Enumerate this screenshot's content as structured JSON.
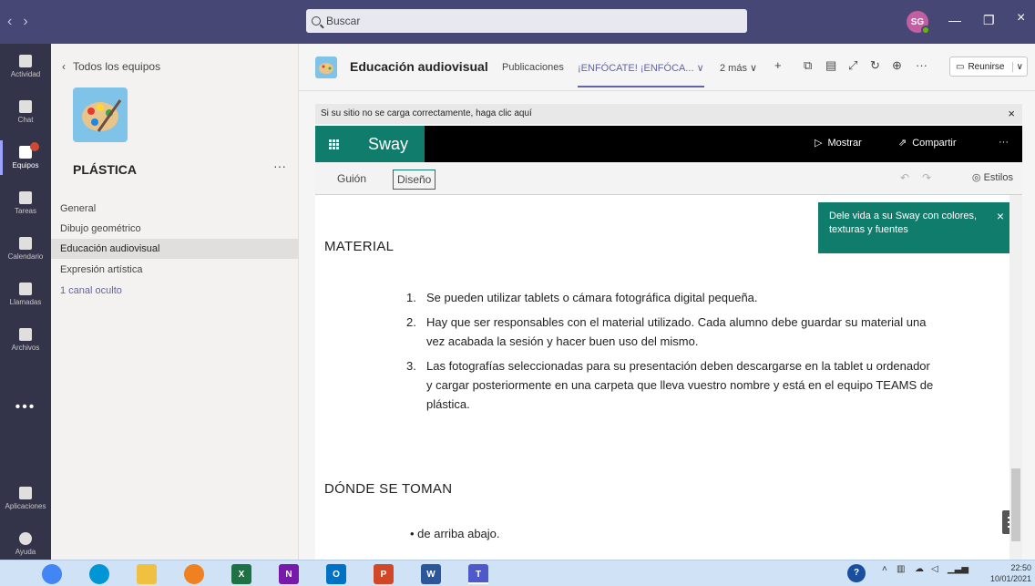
{
  "titlebar": {
    "back": "‹",
    "forward": "›",
    "search_placeholder": "Buscar",
    "avatar_initials": "SG",
    "minimize": "—",
    "maximize": "❐",
    "close": "×"
  },
  "rail": {
    "items": [
      {
        "label": "Actividad"
      },
      {
        "label": "Chat"
      },
      {
        "label": "Equipos"
      },
      {
        "label": "Tareas"
      },
      {
        "label": "Calendario"
      },
      {
        "label": "Llamadas"
      },
      {
        "label": "Archivos"
      }
    ],
    "more": "•••",
    "bottom": [
      {
        "label": "Aplicaciones"
      },
      {
        "label": "Ayuda"
      }
    ]
  },
  "sidebar": {
    "back_label": "Todos los equipos",
    "team_name": "PLÁSTICA",
    "team_more": "···",
    "channels": [
      {
        "label": "General"
      },
      {
        "label": "Dibujo geométrico"
      },
      {
        "label": "Educación audiovisual"
      },
      {
        "label": "Expresión artística"
      },
      {
        "label": "1 canal oculto"
      }
    ]
  },
  "channel": {
    "title": "Educación audiovisual",
    "tabs": [
      "Publicaciones",
      "¡ENFÓCATE! ¡ENFÓCA... ∨",
      "2 más ∨"
    ],
    "meet_label": "Reunirse",
    "notice": "Si su sitio no se carga correctamente, haga clic aquí"
  },
  "sway": {
    "brand": "Sway",
    "show_label": "Mostrar",
    "share_label": "Compartir",
    "more": "···",
    "tabs": [
      "Guión",
      "Diseño"
    ],
    "styles_label": "Estilos",
    "tooltip": "Dele vida a su Sway con colores, texturas y fuentes",
    "heading1": "MATERIAL",
    "items": [
      {
        "num": "1.",
        "text": "Se pueden utilizar tablets o cámara fotográfica digital pequeña."
      },
      {
        "num": "2.",
        "text": "Hay que ser responsables con el material utilizado. Cada alumno debe guardar su material una vez acabada la sesión y hacer buen uso del mismo."
      },
      {
        "num": "3.",
        "text": "Las fotografías seleccionadas para su presentación deben descargarse en la tablet u ordenador y cargar posteriormente en una carpeta que lleva vuestro nombre y está en el equipo TEAMS de plástica."
      }
    ],
    "heading2": "DÓNDE SE TOMAN",
    "bullet1": "de arriba abajo."
  },
  "taskbar": {
    "time": "22:50",
    "date": "10/01/2021"
  },
  "colors": {
    "teams_purple": "#464775",
    "sway_green": "#107c6c",
    "accent": "#6264a7"
  }
}
